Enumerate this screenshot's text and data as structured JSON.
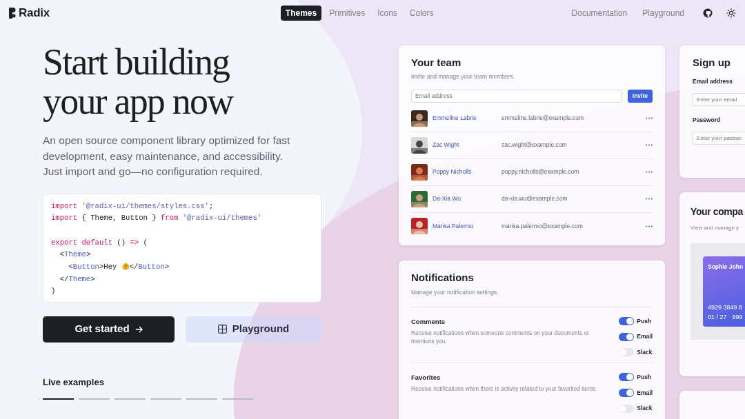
{
  "nav": {
    "logo": "Radix",
    "links": [
      {
        "label": "Themes",
        "selected": true
      },
      {
        "label": "Primitives",
        "selected": false
      },
      {
        "label": "Icons",
        "selected": false
      },
      {
        "label": "Colors",
        "selected": false
      }
    ],
    "right_links": [
      "Documentation",
      "Playground"
    ]
  },
  "hero": {
    "title_lines": [
      "Start building",
      "your app now"
    ],
    "subtitle_lines": [
      "An open source component library optimized for fast",
      "development, easy maintenance, and accessibility.",
      "Just import and go—no configuration required."
    ],
    "code": [
      [
        {
          "text": "import ",
          "kind": "keyword"
        },
        {
          "text": "'@radix-ui/themes/styles.css'",
          "kind": "string"
        },
        {
          "text": ";",
          "kind": "plain"
        }
      ],
      [
        {
          "text": "import",
          "kind": "keyword"
        },
        {
          "text": " { Theme, Button } ",
          "kind": "plain"
        },
        {
          "text": "from ",
          "kind": "keyword"
        },
        {
          "text": "'@radix-ui/themes'",
          "kind": "string"
        }
      ],
      [
        {
          "kind": "blank"
        }
      ],
      [
        {
          "text": "export default",
          "kind": "keyword"
        },
        {
          "text": " () ",
          "kind": "plain"
        },
        {
          "text": "=>",
          "kind": "keyword"
        },
        {
          "text": " (",
          "kind": "plain"
        }
      ],
      [
        {
          "text": "  <",
          "kind": "plain"
        },
        {
          "text": "Theme",
          "kind": "tag"
        },
        {
          "text": ">",
          "kind": "plain"
        }
      ],
      [
        {
          "text": "    <",
          "kind": "plain"
        },
        {
          "text": "Button",
          "kind": "tag"
        },
        {
          "text": ">Hey ",
          "kind": "plain"
        },
        {
          "kind": "emoji"
        },
        {
          "text": "</",
          "kind": "plain"
        },
        {
          "text": "Button",
          "kind": "tag"
        },
        {
          "text": ">",
          "kind": "plain"
        }
      ],
      [
        {
          "text": "  </",
          "kind": "plain"
        },
        {
          "text": "Theme",
          "kind": "tag"
        },
        {
          "text": ">",
          "kind": "plain"
        }
      ],
      [
        {
          "text": ")",
          "kind": "plain"
        }
      ]
    ],
    "buttons": [
      {
        "label": "Get started",
        "kind": "primary"
      },
      {
        "label": "Playground",
        "kind": "secondary"
      }
    ],
    "live_examples": {
      "label": "Live examples",
      "tabs": [
        {
          "selected": true
        },
        {
          "selected": false
        },
        {
          "selected": false
        },
        {
          "selected": false
        },
        {
          "selected": false
        },
        {
          "selected": false
        }
      ]
    }
  },
  "team_card": {
    "title": "Your team",
    "subtitle": "Invite and manage your team members.",
    "email_placeholder": "Email address",
    "invite_button": "Invite",
    "members": [
      {
        "name": "Emmeline Labrie",
        "email": "emmeline.labrie@example.com"
      },
      {
        "name": "Zac Wight",
        "email": "zac.wight@example.com"
      },
      {
        "name": "Poppy Nicholls",
        "email": "poppy.nicholls@example.com"
      },
      {
        "name": "Da-Xia Wu",
        "email": "da-xia.wu@example.com"
      },
      {
        "name": "Marisa Palermo",
        "email": "marisa.palermo@example.com"
      }
    ]
  },
  "notifications_card": {
    "title": "Notifications",
    "subtitle": "Manage your notification settings.",
    "groups": [
      {
        "title": "Comments",
        "description": "Receive notifications when someone comments on your documents or mentions you.",
        "channels": [
          {
            "label": "Push",
            "on": true
          },
          {
            "label": "Email",
            "on": true
          },
          {
            "label": "Slack",
            "on": false
          }
        ]
      },
      {
        "title": "Favorites",
        "description": "Receive notifications when there is activity related to your favorited items.",
        "channels": [
          {
            "label": "Push",
            "on": true
          },
          {
            "label": "Email",
            "on": true
          },
          {
            "label": "Slack",
            "on": false
          }
        ]
      }
    ]
  },
  "signup_card": {
    "title": "Sign up",
    "fields": [
      {
        "label": "Email address",
        "placeholder": "Enter your email"
      },
      {
        "label": "Password",
        "placeholder": "Enter your passwo"
      }
    ]
  },
  "company_card": {
    "title": "Your compa",
    "subtitle": "View and manage y",
    "card": {
      "holder": "Sophie John",
      "number": "4929 3849 8",
      "expiry": "01 / 27",
      "cvc": "999"
    }
  }
}
